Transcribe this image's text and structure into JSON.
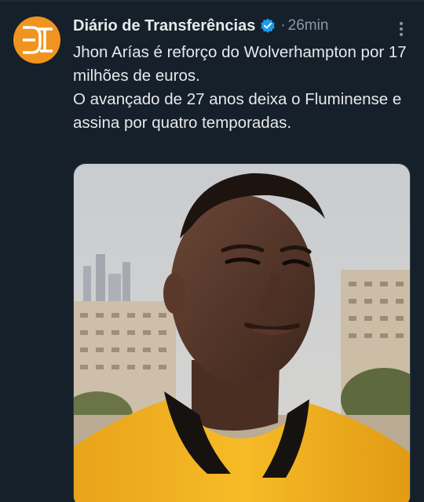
{
  "account": {
    "display_name": "Diário de Transferências",
    "verified": true,
    "separator": "·",
    "time": "26min",
    "avatar_icon": "dt-logo-icon",
    "avatar_color": "#f0941f"
  },
  "tweet": {
    "lines": [
      "Jhon Arías é reforço do Wolverhampton por 17 milhões de euros.",
      "O avançado de 27 anos deixa o Fluminense e assina por quatro temporadas."
    ]
  },
  "media": {
    "type": "photo",
    "subject": "player-portrait"
  },
  "colors": {
    "background": "#15202b",
    "text": "#e7e9ea",
    "muted": "#8b98a5",
    "verified": "#1d9bf0",
    "jersey": "#f5b820"
  }
}
